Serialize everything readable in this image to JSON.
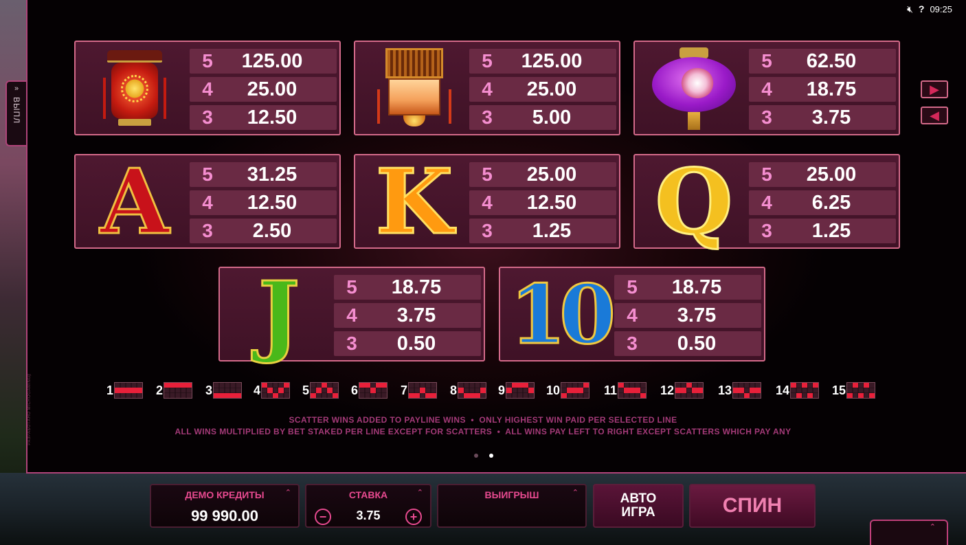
{
  "topbar": {
    "time": "09:25",
    "sound_icon": "speaker-mute-icon",
    "help_icon": "question-icon"
  },
  "side_tab": {
    "arrows": "»",
    "label": "ВЫПЛ"
  },
  "credit_vertical": "РАЗРАБОТАНО MICROGAMING™",
  "paytable": [
    {
      "symbol": "red-lantern",
      "rows": [
        {
          "count": "5",
          "value": "125.00"
        },
        {
          "count": "4",
          "value": "25.00"
        },
        {
          "count": "3",
          "value": "12.50"
        }
      ]
    },
    {
      "symbol": "hex-lantern",
      "rows": [
        {
          "count": "5",
          "value": "125.00"
        },
        {
          "count": "4",
          "value": "25.00"
        },
        {
          "count": "3",
          "value": "5.00"
        }
      ]
    },
    {
      "symbol": "purple-lantern",
      "rows": [
        {
          "count": "5",
          "value": "62.50"
        },
        {
          "count": "4",
          "value": "18.75"
        },
        {
          "count": "3",
          "value": "3.75"
        }
      ]
    },
    {
      "symbol": "A",
      "rows": [
        {
          "count": "5",
          "value": "31.25"
        },
        {
          "count": "4",
          "value": "12.50"
        },
        {
          "count": "3",
          "value": "2.50"
        }
      ]
    },
    {
      "symbol": "K",
      "rows": [
        {
          "count": "5",
          "value": "25.00"
        },
        {
          "count": "4",
          "value": "12.50"
        },
        {
          "count": "3",
          "value": "1.25"
        }
      ]
    },
    {
      "symbol": "Q",
      "rows": [
        {
          "count": "5",
          "value": "25.00"
        },
        {
          "count": "4",
          "value": "6.25"
        },
        {
          "count": "3",
          "value": "1.25"
        }
      ]
    },
    {
      "symbol": "J",
      "rows": [
        {
          "count": "5",
          "value": "18.75"
        },
        {
          "count": "4",
          "value": "3.75"
        },
        {
          "count": "3",
          "value": "0.50"
        }
      ]
    },
    {
      "symbol": "10",
      "rows": [
        {
          "count": "5",
          "value": "18.75"
        },
        {
          "count": "4",
          "value": "3.75"
        },
        {
          "count": "3",
          "value": "0.50"
        }
      ]
    }
  ],
  "nav": {
    "next_icon": "play-right-icon",
    "prev_icon": "play-left-icon"
  },
  "paylines": [
    "1",
    "2",
    "3",
    "4",
    "5",
    "6",
    "7",
    "8",
    "9",
    "10",
    "11",
    "12",
    "13",
    "14",
    "15"
  ],
  "rules": {
    "line1": "SCATTER WINS ADDED TO PAYLINE WINS  •  ONLY HIGHEST WIN PAID PER SELECTED LINE",
    "line2": "ALL WINS MULTIPLIED BY BET STAKED PER LINE EXCEPT FOR SCATTERS  •  ALL WINS PAY LEFT TO RIGHT EXCEPT SCATTERS WHICH PAY ANY"
  },
  "pager": {
    "pages": 2,
    "active": 2
  },
  "bottom": {
    "credits_label": "ДЕМО КРЕДИТЫ",
    "credits_value": "99 990.00",
    "bet_label": "СТАВКА",
    "bet_value": "3.75",
    "bet_minus": "−",
    "bet_plus": "+",
    "win_label": "ВЫИГРЫШ",
    "win_value": "",
    "auto_label_1": "АВТО",
    "auto_label_2": "ИГРА",
    "spin_label": "СПИН",
    "chevron": "⌃"
  },
  "colors": {
    "accent": "#e84a90",
    "card_border": "#d46a8a",
    "count": "#f58ed0",
    "rule_text": "#a43a78"
  }
}
